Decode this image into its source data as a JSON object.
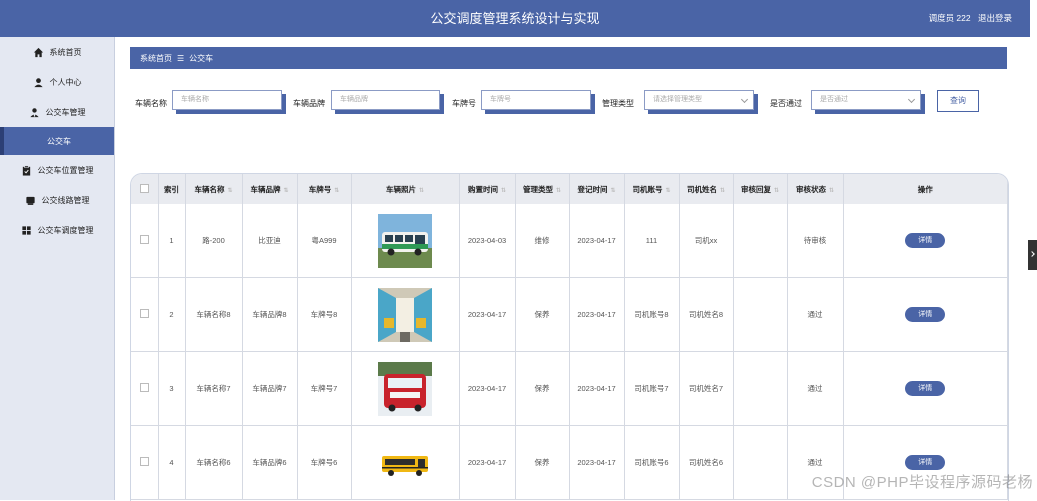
{
  "header": {
    "title": "公交调度管理系统设计与实现",
    "user": "调度员 222",
    "logout": "退出登录"
  },
  "sidebar": {
    "items": [
      {
        "label": "系统首页",
        "icon": "home-icon"
      },
      {
        "label": "个人中心",
        "icon": "user-icon"
      },
      {
        "label": "公交车管理",
        "icon": "user-admin-icon"
      },
      {
        "label": "公交车",
        "icon": "",
        "active": true
      },
      {
        "label": "公交车位置管理",
        "icon": "clipboard-icon"
      },
      {
        "label": "公交线路管理",
        "icon": "folder-icon"
      },
      {
        "label": "公交车调度管理",
        "icon": "grid-icon"
      }
    ]
  },
  "breadcrumb": {
    "home": "系统首页",
    "sep": "☰",
    "current": "公交车"
  },
  "filters": {
    "vehicle_name_label": "车辆名称",
    "vehicle_name_placeholder": "车辆名称",
    "brand_label": "车辆品牌",
    "brand_placeholder": "车辆品牌",
    "plate_label": "车牌号",
    "plate_placeholder": "车牌号",
    "mgmt_type_label": "管理类型",
    "mgmt_type_placeholder": "请选择管理类型",
    "passed_label": "是否通过",
    "passed_placeholder": "是否通过",
    "query_button": "查询"
  },
  "table": {
    "headers": [
      "",
      "索引",
      "车辆名称",
      "车辆品牌",
      "车牌号",
      "车辆照片",
      "购置时间",
      "管理类型",
      "登记时间",
      "司机账号",
      "司机姓名",
      "审核回复",
      "审核状态",
      "操作"
    ],
    "detail_label": "详情",
    "rows": [
      {
        "index": "1",
        "name": "路-200",
        "brand": "比亚迪",
        "plate": "粤A999",
        "photo": "green-white-bus",
        "purchase": "2023-04-03",
        "type": "维修",
        "register": "2023-04-17",
        "driver_acct": "111",
        "driver_name": "司机xx",
        "reply": "",
        "status": "待审核"
      },
      {
        "index": "2",
        "name": "车辆名称8",
        "brand": "车辆品牌8",
        "plate": "车牌号8",
        "photo": "bus-interior",
        "purchase": "2023-04-17",
        "type": "保养",
        "register": "2023-04-17",
        "driver_acct": "司机账号8",
        "driver_name": "司机姓名8",
        "reply": "",
        "status": "通过"
      },
      {
        "index": "3",
        "name": "车辆名称7",
        "brand": "车辆品牌7",
        "plate": "车牌号7",
        "photo": "red-bus",
        "purchase": "2023-04-17",
        "type": "保养",
        "register": "2023-04-17",
        "driver_acct": "司机账号7",
        "driver_name": "司机姓名7",
        "reply": "",
        "status": "通过"
      },
      {
        "index": "4",
        "name": "车辆名称6",
        "brand": "车辆品牌6",
        "plate": "车牌号6",
        "photo": "yellow-school-bus",
        "purchase": "2023-04-17",
        "type": "保养",
        "register": "2023-04-17",
        "driver_acct": "司机账号6",
        "driver_name": "司机姓名6",
        "reply": "",
        "status": "通过"
      }
    ]
  },
  "watermark": "CSDN @PHP毕设程序源码老杨",
  "colors": {
    "primary": "#4a64a6",
    "sidebar_bg": "#e4e8f2"
  }
}
